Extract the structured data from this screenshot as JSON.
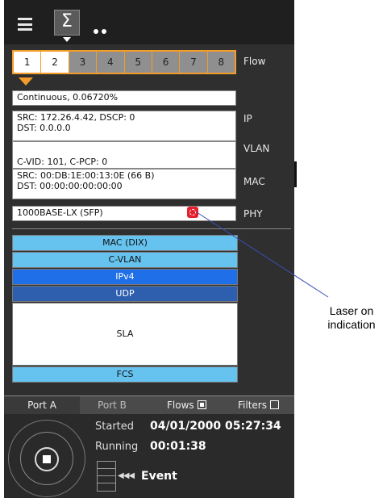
{
  "toolbar": {
    "menu_icon": "hamburger-icon",
    "sigma_glyph": "Σ",
    "more_icon": "dots-icon"
  },
  "flow": {
    "label": "Flow",
    "tabs": [
      "1",
      "2",
      "3",
      "4",
      "5",
      "6",
      "7",
      "8"
    ],
    "selected": "1"
  },
  "stream": {
    "mode": "Continuous, 0.06720%"
  },
  "ip": {
    "label": "IP",
    "line1": "SRC: 172.26.4.42, DSCP: 0",
    "line2": "DST: 0.0.0.0"
  },
  "vlan": {
    "label": "VLAN",
    "line1": "C-VID: 101, C-PCP: 0"
  },
  "mac": {
    "label": "MAC",
    "line1": "SRC: 00:DB:1E:00:13:0E (66 B)",
    "line2": "DST: 00:00:00:00:00:00"
  },
  "phy": {
    "label": "PHY",
    "value": "1000BASE-LX (SFP)",
    "laser_icon": "laser-on-icon"
  },
  "stack": {
    "layers": [
      "MAC (DIX)",
      "C-VLAN",
      "IPv4",
      "UDP",
      "SLA",
      "FCS"
    ]
  },
  "bottom_tabs": {
    "port_a": "Port A",
    "port_b": "Port B",
    "flows": "Flows",
    "filters": "Filters"
  },
  "status": {
    "started_label": "Started",
    "started_value": "04/01/2000 05:27:34",
    "running_label": "Running",
    "running_value": "00:01:38",
    "event_label": "Event"
  },
  "callout": {
    "text_line1": "Laser on",
    "text_line2": "indication"
  },
  "colors": {
    "accent": "#f39c2a",
    "ipv4": "#1e6fe8",
    "udp": "#2e5fae",
    "mac": "#66c2ee",
    "laser": "#e5202e"
  }
}
